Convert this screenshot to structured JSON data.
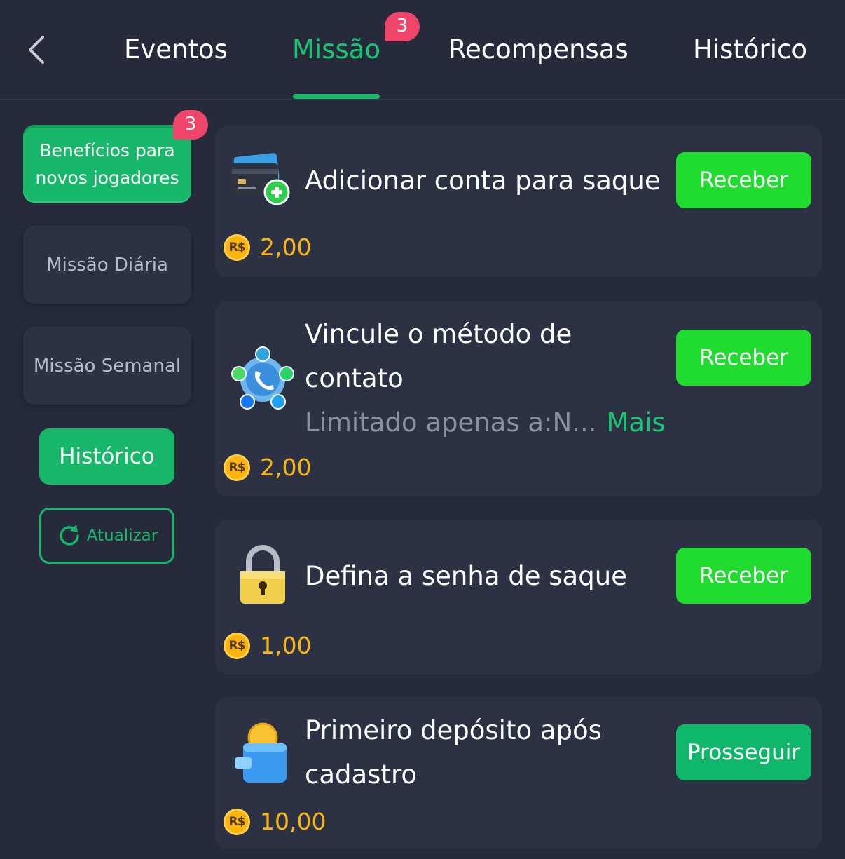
{
  "nav": {
    "tabs": [
      {
        "label": "Eventos",
        "active": false
      },
      {
        "label": "Missão",
        "active": true,
        "badge": "3"
      },
      {
        "label": "Recompensas",
        "active": false
      },
      {
        "label": "Histórico",
        "active": false
      }
    ]
  },
  "sidebar": {
    "items": [
      {
        "label": "Benefícios para novos jogadores",
        "active": true,
        "badge": "3"
      },
      {
        "label": "Missão Diária",
        "active": false
      },
      {
        "label": "Missão Semanal",
        "active": false
      }
    ],
    "history_label": "Histórico",
    "refresh_label": "Atualizar"
  },
  "currency_symbol": "R$",
  "missions": [
    {
      "title": "Adicionar conta para saque",
      "reward": "2,00",
      "button": "Receber",
      "icon": "bank-card-add-icon"
    },
    {
      "title": "Vincule o método de contato",
      "subtitle": "Limitado apenas a:N...",
      "more": "Mais",
      "reward": "2,00",
      "button": "Receber",
      "icon": "contact-methods-icon"
    },
    {
      "title": "Defina a senha de saque",
      "reward": "1,00",
      "button": "Receber",
      "icon": "padlock-icon"
    },
    {
      "title": "Primeiro depósito após cadastro",
      "reward": "10,00",
      "button": "Prosseguir",
      "icon": "wallet-coin-icon"
    }
  ],
  "colors": {
    "background": "#262a3a",
    "card": "#2c3144",
    "accent_green": "#17b86a",
    "button_green": "#1fdc2f",
    "badge_red": "#f0456b",
    "coin_gold": "#f9b50e"
  }
}
